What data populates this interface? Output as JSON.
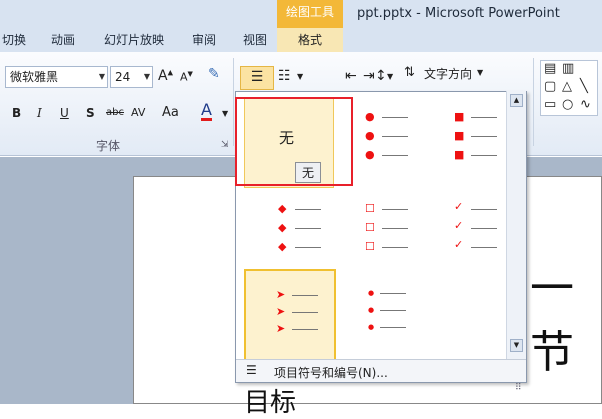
{
  "window": {
    "context_tab_title": "绘图工具",
    "title": "ppt.pptx - Microsoft PowerPoint"
  },
  "tabs": [
    "切换",
    "动画",
    "幻灯片放映",
    "审阅",
    "视图",
    "格式"
  ],
  "font_group": {
    "font_name": "微软雅黑",
    "font_size": "24",
    "label": "字体",
    "buttons": [
      "B",
      "I",
      "U",
      "S",
      "abc",
      "AV",
      "Aa",
      "A"
    ]
  },
  "paragraph": {
    "text_direction_label": "文字方向"
  },
  "bullet_gallery": {
    "none_label": "无",
    "tooltip": "无",
    "styles": [
      "none",
      "filled-round",
      "filled-square",
      "diamond",
      "hollow-square",
      "checkmark",
      "arrow",
      "small-dot"
    ],
    "footer_label": "项目符号和编号(N)...",
    "bullet_color": "#e11b1b"
  },
  "slide": {
    "title_partial": "一节",
    "bottom_partial": "目标"
  },
  "colors": {
    "accent_highlight": "#e8202a",
    "context_tab": "#f3b838"
  }
}
